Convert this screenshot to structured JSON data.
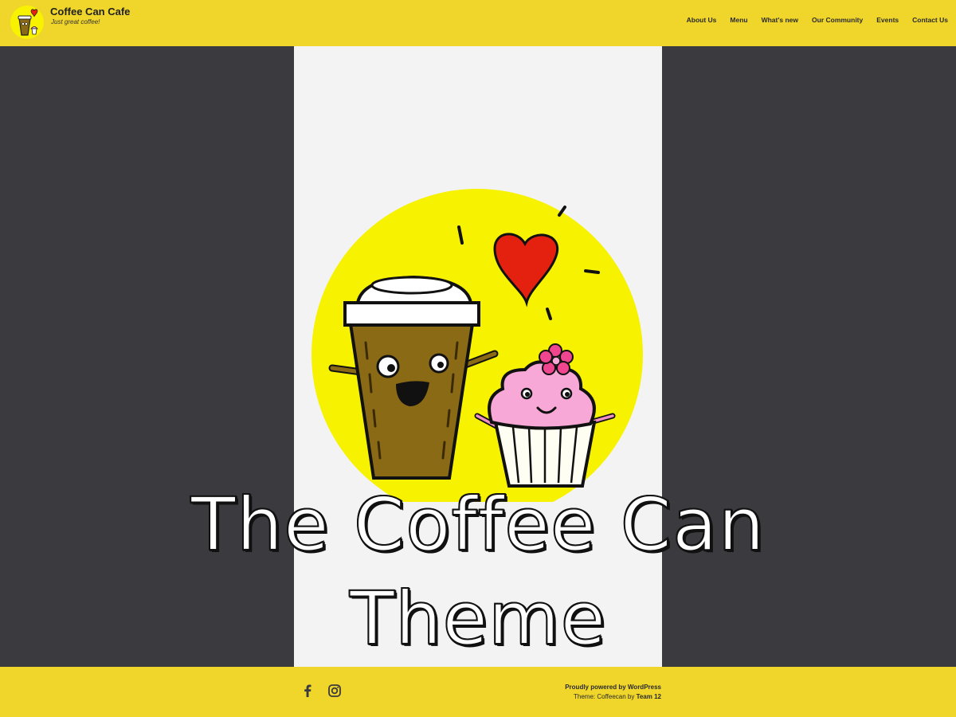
{
  "header": {
    "site_title": "Coffee Can Cafe",
    "tagline": "Just great coffee!",
    "nav": [
      "About Us",
      "Menu",
      "What's new",
      "Our Community",
      "Events",
      "Contact Us"
    ]
  },
  "hero": {
    "title_line1": "The Coffee Can",
    "title_line2": "Theme"
  },
  "footer": {
    "social_icons": [
      "facebook-icon",
      "instagram-icon"
    ],
    "powered_by": "Proudly powered by WordPress",
    "theme_prefix": "Theme: Coffeecan by ",
    "theme_author": "Team 12"
  },
  "colors": {
    "header_footer_yellow": "#f0d62a",
    "background_dark": "#3b3a3f",
    "hero_panel": "#f3f3f3",
    "mascot_circle": "#f7f200"
  }
}
